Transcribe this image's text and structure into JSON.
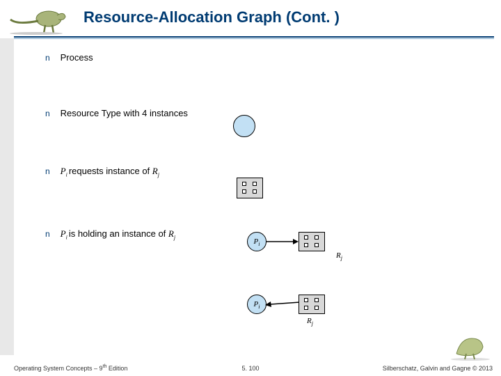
{
  "title": "Resource-Allocation Graph (Cont. )",
  "bullets": {
    "b1": "Process",
    "b2": "Resource Type with 4 instances",
    "b3_pre": "P",
    "b3_i": "i ",
    "b3_mid": "requests instance of ",
    "b3_r": "R",
    "b3_j": "j",
    "b4_pre": "P",
    "b4_i": "i ",
    "b4_mid": "is holding an instance of ",
    "b4_r": "R",
    "b4_j": "j"
  },
  "labels": {
    "Pi_P": "P",
    "Pi_i": "i",
    "Rj_R": "R",
    "Rj_j": "j"
  },
  "footer": {
    "left_a": "Operating System Concepts – 9",
    "left_sup": "th",
    "left_b": " Edition",
    "center": "5. 100",
    "right": "Silberschatz, Galvin and Gagne © 2013"
  },
  "bullet_glyph": "n"
}
